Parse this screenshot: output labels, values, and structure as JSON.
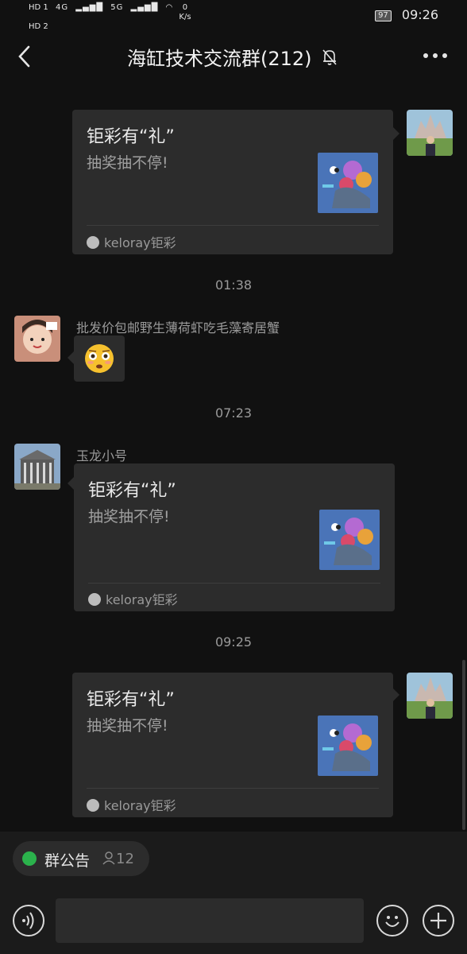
{
  "status_bar": {
    "hd1": "HD 1",
    "hd2": "HD 2",
    "net1": "4G",
    "net2": "5G",
    "speed_value": "0",
    "speed_unit": "K/s",
    "battery": "97",
    "time": "09:26"
  },
  "header": {
    "title": "海缸技术交流群(212)"
  },
  "messages": {
    "card1": {
      "title": "钜彩有“礼”",
      "desc": "抽奖抽不停!",
      "source": "keloray钜彩"
    },
    "time1": "01:38",
    "msg2": {
      "sender": "批发价包邮野生薄荷虾吃毛藻寄居蟹",
      "emoji": "😳"
    },
    "time2": "07:23",
    "msg3": {
      "sender": "玉龙小号",
      "title": "钜彩有“礼”",
      "desc": "抽奖抽不停!",
      "source": "keloray钜彩"
    },
    "time3": "09:25",
    "card4": {
      "title": "钜彩有“礼”",
      "desc": "抽奖抽不停!",
      "source": "keloray钜彩"
    }
  },
  "bottom": {
    "notice_label": "群公告",
    "notice_count": "12"
  },
  "colors": {
    "background": "#111111",
    "bubble": "#2c2c2c",
    "notice_green": "#2bb24c"
  },
  "icons": [
    "back-arrow-icon",
    "mute-bell-icon",
    "more-dots-icon",
    "voice-icon",
    "emoji-icon",
    "plus-icon",
    "person-icon",
    "notice-icon"
  ]
}
